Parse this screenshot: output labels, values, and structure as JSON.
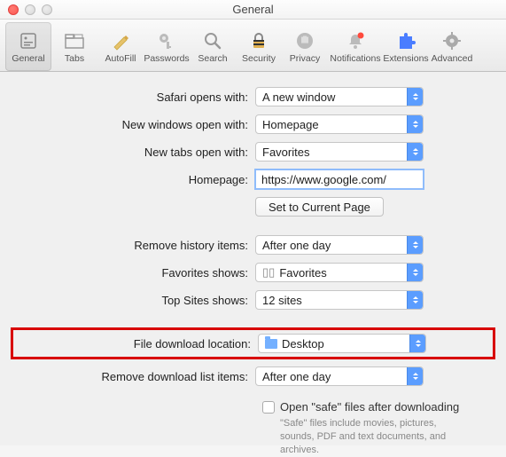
{
  "window": {
    "title": "General"
  },
  "toolbar": {
    "items": [
      {
        "label": "General",
        "icon": "general"
      },
      {
        "label": "Tabs",
        "icon": "tabs"
      },
      {
        "label": "AutoFill",
        "icon": "autofill"
      },
      {
        "label": "Passwords",
        "icon": "passwords"
      },
      {
        "label": "Search",
        "icon": "search"
      },
      {
        "label": "Security",
        "icon": "security"
      },
      {
        "label": "Privacy",
        "icon": "privacy"
      },
      {
        "label": "Notifications",
        "icon": "notifications"
      },
      {
        "label": "Extensions",
        "icon": "extensions"
      },
      {
        "label": "Advanced",
        "icon": "advanced"
      }
    ],
    "selected_index": 0
  },
  "labels": {
    "safari_opens": "Safari opens with:",
    "new_windows": "New windows open with:",
    "new_tabs": "New tabs open with:",
    "homepage": "Homepage:",
    "set_current": "Set to Current Page",
    "remove_history": "Remove history items:",
    "favorites_shows": "Favorites shows:",
    "top_sites": "Top Sites shows:",
    "download_location": "File download location:",
    "remove_downloads": "Remove download list items:",
    "open_safe": "Open \"safe\" files after downloading",
    "safe_hint": "\"Safe\" files include movies, pictures, sounds, PDF and text documents, and archives."
  },
  "values": {
    "safari_opens": "A new window",
    "new_windows": "Homepage",
    "new_tabs": "Favorites",
    "homepage": "https://www.google.com/",
    "remove_history": "After one day",
    "favorites_shows": "Favorites",
    "top_sites": "12 sites",
    "download_location": "Desktop",
    "remove_downloads": "After one day",
    "open_safe_checked": false
  }
}
